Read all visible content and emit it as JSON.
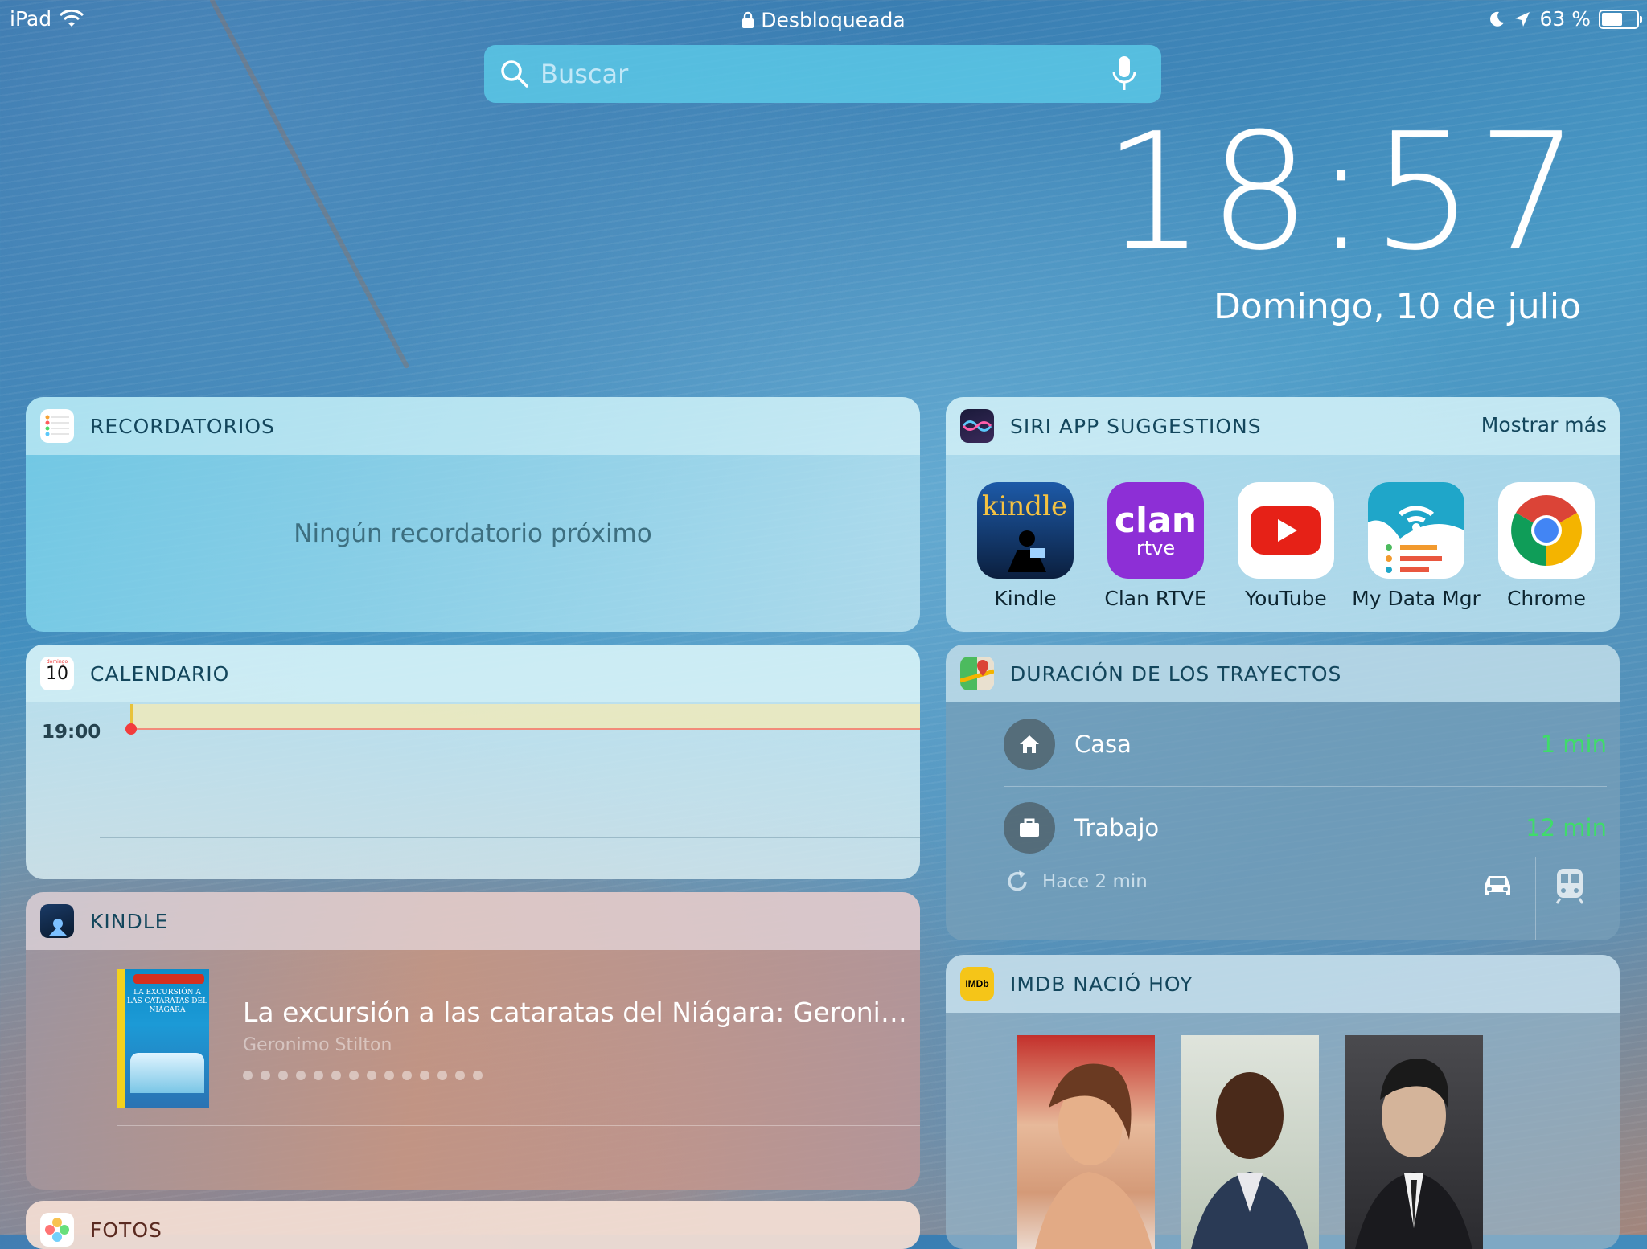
{
  "status_bar": {
    "device": "iPad",
    "lock_status": "Desbloqueada",
    "battery": "63 %",
    "battery_level": 0.63
  },
  "search": {
    "placeholder": "Buscar"
  },
  "clock": {
    "time": "18:57",
    "date": "Domingo, 10 de julio"
  },
  "reminders": {
    "title": "RECORDATORIOS",
    "empty_text": "Ningún recordatorio próximo"
  },
  "calendar": {
    "title": "CALENDARIO",
    "icon_day_label": "domingo",
    "icon_day_number": "10",
    "hour_label": "19:00"
  },
  "kindle": {
    "title": "KINDLE",
    "book_title": "La excursión a las cataratas del Niágara: Geronimo…",
    "book_author": "Geronimo Stilton",
    "cover_text": "LA EXCURSIÓN A LAS CATARATAS DEL NIÁGARA",
    "dots": 14
  },
  "fotos": {
    "title": "FOTOS"
  },
  "siri": {
    "title": "SIRI APP SUGGESTIONS",
    "more_label": "Mostrar más",
    "apps": [
      {
        "label": "Kindle",
        "icon": "kindle-app-icon"
      },
      {
        "label": "Clan RTVE",
        "icon": "clan-rtve-app-icon"
      },
      {
        "label": "YouTube",
        "icon": "youtube-app-icon"
      },
      {
        "label": "My Data Mgr",
        "icon": "my-data-mgr-app-icon"
      },
      {
        "label": "Chrome",
        "icon": "chrome-app-icon"
      }
    ],
    "clan_word": "clan",
    "rtve_word": "rtve",
    "kindle_word": "kindle"
  },
  "maps": {
    "title": "DURACIÓN DE LOS TRAYECTOS",
    "routes": [
      {
        "name": "Casa",
        "time": "1 min",
        "icon": "home-icon"
      },
      {
        "name": "Trabajo",
        "time": "12 min",
        "icon": "briefcase-icon"
      }
    ],
    "updated": "Hace 2 min",
    "colors": {
      "time": "#3fdc6a"
    }
  },
  "imdb": {
    "title": "IMDB NACIÓ HOY",
    "icon_text": "IMDb"
  }
}
